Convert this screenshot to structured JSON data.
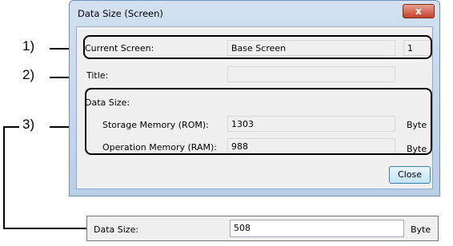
{
  "window": {
    "title": "Data Size (Screen)",
    "close_glyph": "x"
  },
  "current_screen": {
    "label": "Current Screen:",
    "value": "Base Screen",
    "number": "1"
  },
  "title_field": {
    "label": "Title:",
    "value": ""
  },
  "data_size": {
    "label": "Data Size:",
    "rom_label": "Storage Memory (ROM):",
    "rom_value": "1303",
    "rom_unit": "Byte",
    "ram_label": "Operation Memory (RAM):",
    "ram_value": "988",
    "ram_unit": "Byte"
  },
  "buttons": {
    "close": "Close"
  },
  "callouts": {
    "c1": "1)",
    "c2": "2)",
    "c3": "3)"
  },
  "alt_data_size": {
    "label": "Data Size:",
    "value": "508",
    "unit": "Byte"
  }
}
